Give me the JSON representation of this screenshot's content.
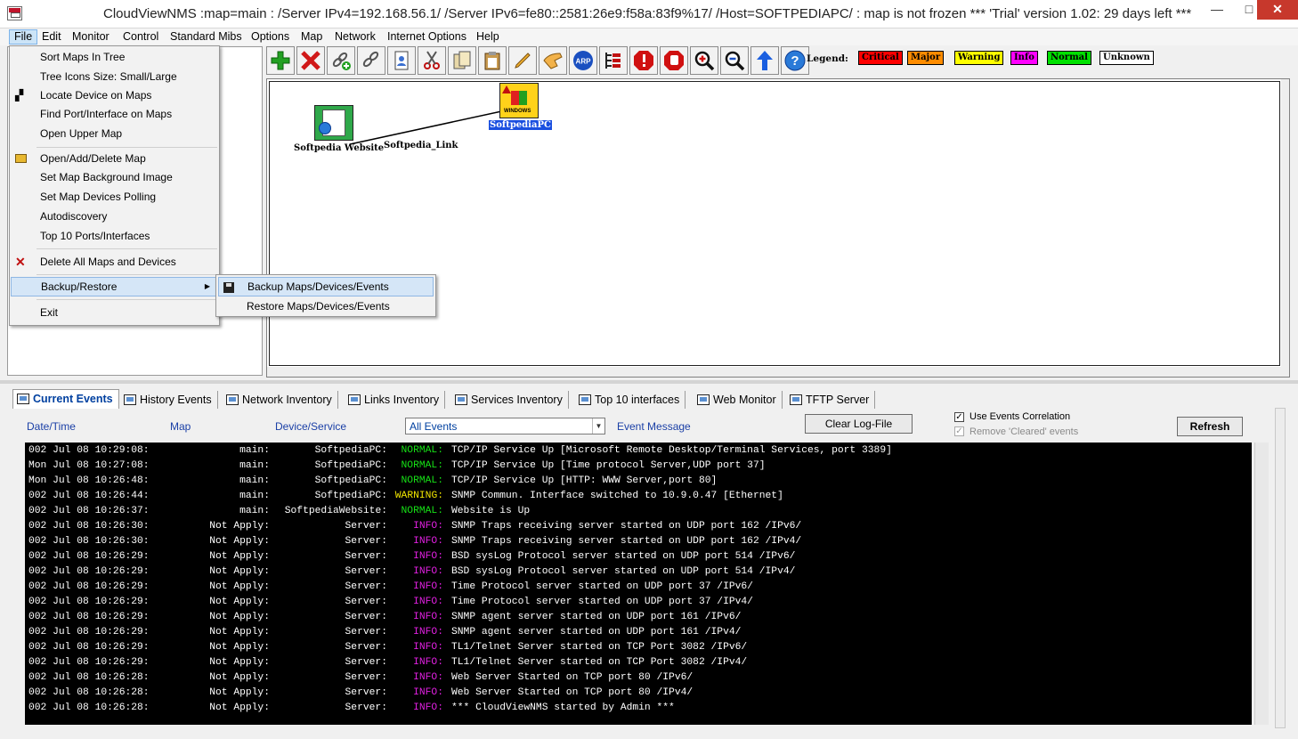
{
  "window": {
    "title": "CloudViewNMS :map=main :   /Server IPv4=192.168.56.1/ /Server IPv6=fe80::2581:26e9:f58a:83f9%17/ /Host=SOFTPEDIAPC/  : map is not frozen          *** 'Trial' version 1.02: 29 days left ***",
    "minimize": "—",
    "maximize": "□",
    "close": "✕"
  },
  "menubar": [
    "File",
    "Edit",
    "Monitor",
    "Control",
    "Standard Mibs",
    "Options",
    "Map",
    "Network",
    "Internet Options",
    "Help"
  ],
  "file_menu": {
    "items": [
      {
        "label": "Sort Maps In Tree",
        "icon": ""
      },
      {
        "label": "Tree Icons Size: Small/Large",
        "icon": ""
      },
      {
        "label": "Locate Device on Maps",
        "icon": "binoculars-icon"
      },
      {
        "label": "Find Port/Interface on Maps",
        "icon": ""
      },
      {
        "label": "Open Upper Map",
        "icon": ""
      },
      {
        "label": "Open/Add/Delete Map",
        "icon": "folder-open-icon"
      },
      {
        "label": "Set Map Background Image",
        "icon": ""
      },
      {
        "label": "Set Map Devices Polling",
        "icon": ""
      },
      {
        "label": "Autodiscovery",
        "icon": ""
      },
      {
        "label": "Top 10 Ports/Interfaces",
        "icon": ""
      },
      {
        "label": "Delete All Maps and Devices",
        "icon": "delete-x-icon"
      },
      {
        "label": "Backup/Restore",
        "icon": "",
        "submenu": true
      },
      {
        "label": "Exit",
        "icon": ""
      }
    ],
    "submenu": [
      {
        "label": "Backup  Maps/Devices/Events",
        "icon": "floppy-disk-icon"
      },
      {
        "label": "Restore Maps/Devices/Events",
        "icon": ""
      }
    ]
  },
  "toolbar": {
    "buttons": [
      "add-device",
      "delete-device",
      "add-link",
      "delete-link",
      "device-properties",
      "cut",
      "copy",
      "paste",
      "edit",
      "ping",
      "arp",
      "tree-view",
      "stop-red",
      "stop-alert",
      "zoom-in",
      "zoom-out",
      "upper-map",
      "help"
    ],
    "arp_label": "ARP",
    "legend_label": "Legend:",
    "legend": [
      {
        "label": "Critical",
        "color": "#ff0000"
      },
      {
        "label": "Major",
        "color": "#ff8c00"
      },
      {
        "label": "Warning",
        "color": "#ffff00"
      },
      {
        "label": "Info",
        "color": "#ff00ff"
      },
      {
        "label": "Normal",
        "color": "#00e000"
      },
      {
        "label": "Unknown",
        "color": "#ffffff"
      }
    ]
  },
  "map": {
    "nodes": [
      {
        "label": "Softpedia Website"
      },
      {
        "label": "SoftpediaPC",
        "badge": "WINDOWS"
      }
    ],
    "link_label": "Softpedia_Link"
  },
  "tabs": [
    "Current Events",
    "History Events",
    "Network Inventory",
    "Links Inventory",
    "Services Inventory",
    "Top 10 interfaces",
    "Web Monitor",
    "TFTP Server"
  ],
  "events_panel": {
    "columns": [
      "Date/Time",
      "Map",
      "Device/Service",
      "Event Message"
    ],
    "filter_value": "All Events",
    "clear_button": "Clear Log-File",
    "refresh_button": "Refresh",
    "use_correlation": "Use Events Correlation",
    "remove_cleared": "Remove 'Cleared' events",
    "check_mark": "✓"
  },
  "log_rows": [
    {
      "date": "002 Jul 08 10:29:08:",
      "map": "main:",
      "device": "SoftpediaPC:",
      "severity": "NORMAL:",
      "message": "TCP/IP Service Up [Microsoft Remote Desktop/Terminal Services, port 3389]"
    },
    {
      "date": "Mon Jul 08 10:27:08:",
      "map": "main:",
      "device": "SoftpediaPC:",
      "severity": "NORMAL:",
      "message": "TCP/IP Service Up [Time protocol Server,UDP port 37]"
    },
    {
      "date": "Mon Jul 08 10:26:48:",
      "map": "main:",
      "device": "SoftpediaPC:",
      "severity": "NORMAL:",
      "message": "TCP/IP Service Up [HTTP: WWW Server,port 80]"
    },
    {
      "date": "002 Jul 08 10:26:44:",
      "map": "main:",
      "device": "SoftpediaPC:",
      "severity": "WARNING:",
      "message": "SNMP Commun. Interface switched to 10.9.0.47 [Ethernet]"
    },
    {
      "date": "002 Jul 08 10:26:37:",
      "map": "main:",
      "device": "SoftpediaWebsite:",
      "severity": "NORMAL:",
      "message": "Website is Up"
    },
    {
      "date": "002 Jul 08 10:26:30:",
      "map": "Not Apply:",
      "device": "Server:",
      "severity": "INFO:",
      "message": "SNMP Traps receiving server started on UDP port 162 /IPv6/"
    },
    {
      "date": "002 Jul 08 10:26:30:",
      "map": "Not Apply:",
      "device": "Server:",
      "severity": "INFO:",
      "message": "SNMP Traps receiving server started on UDP port 162 /IPv4/"
    },
    {
      "date": "002 Jul 08 10:26:29:",
      "map": "Not Apply:",
      "device": "Server:",
      "severity": "INFO:",
      "message": "BSD sysLog Protocol server started on UDP port 514 /IPv6/"
    },
    {
      "date": "002 Jul 08 10:26:29:",
      "map": "Not Apply:",
      "device": "Server:",
      "severity": "INFO:",
      "message": "BSD sysLog Protocol server started on UDP port 514 /IPv4/"
    },
    {
      "date": "002 Jul 08 10:26:29:",
      "map": "Not Apply:",
      "device": "Server:",
      "severity": "INFO:",
      "message": "Time Protocol server started on UDP port 37 /IPv6/"
    },
    {
      "date": "002 Jul 08 10:26:29:",
      "map": "Not Apply:",
      "device": "Server:",
      "severity": "INFO:",
      "message": "Time Protocol server started on UDP port 37 /IPv4/"
    },
    {
      "date": "002 Jul 08 10:26:29:",
      "map": "Not Apply:",
      "device": "Server:",
      "severity": "INFO:",
      "message": "SNMP agent server started on UDP port 161 /IPv6/"
    },
    {
      "date": "002 Jul 08 10:26:29:",
      "map": "Not Apply:",
      "device": "Server:",
      "severity": "INFO:",
      "message": "SNMP agent server started on UDP port 161 /IPv4/"
    },
    {
      "date": "002 Jul 08 10:26:29:",
      "map": "Not Apply:",
      "device": "Server:",
      "severity": "INFO:",
      "message": "TL1/Telnet Server started on TCP Port 3082 /IPv6/"
    },
    {
      "date": "002 Jul 08 10:26:29:",
      "map": "Not Apply:",
      "device": "Server:",
      "severity": "INFO:",
      "message": "TL1/Telnet Server started on TCP Port 3082 /IPv4/"
    },
    {
      "date": "002 Jul 08 10:26:28:",
      "map": "Not Apply:",
      "device": "Server:",
      "severity": "INFO:",
      "message": "Web Server Started on TCP port 80 /IPv6/"
    },
    {
      "date": "002 Jul 08 10:26:28:",
      "map": "Not Apply:",
      "device": "Server:",
      "severity": "INFO:",
      "message": "Web Server Started on TCP port 80 /IPv4/"
    },
    {
      "date": "002 Jul 08 10:26:28:",
      "map": "Not Apply:",
      "device": "Server:",
      "severity": "INFO:",
      "message": "*** CloudViewNMS started by Admin ***"
    }
  ]
}
